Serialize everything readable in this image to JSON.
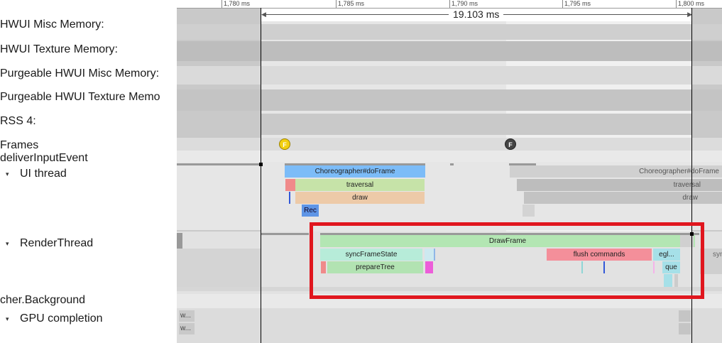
{
  "sidebar": {
    "tracks": [
      "HWUI Misc Memory:",
      "HWUI Texture Memory:",
      "Purgeable HWUI Misc Memory:",
      "Purgeable HWUI Texture Memo",
      "RSS 4:",
      "Frames",
      "deliverInputEvent",
      "UI thread",
      "RenderThread",
      "cher.Background",
      "GPU completion"
    ],
    "caret": "▾"
  },
  "ruler": {
    "ticks": [
      "1,780 ms",
      "1,785 ms",
      "1,790 ms",
      "1,795 ms",
      "1,800 ms"
    ],
    "selection_duration": "19.103 ms"
  },
  "frames": {
    "marker_label": "F",
    "colors": {
      "good": "#f2cf10",
      "janky": "#444444"
    }
  },
  "ui_thread": {
    "slices": [
      "Choreographer#doFrame",
      "traversal",
      "draw",
      "Rec"
    ],
    "faded_slices": [
      "Choreographer#doFrame",
      "traversal",
      "draw"
    ]
  },
  "render_thread": {
    "slices": [
      "DrawFrame",
      "syncFrameState",
      "prepareTree",
      "flush commands",
      "egl...",
      "que",
      "sync"
    ]
  },
  "gpu_completion": {
    "slices": [
      "w...",
      "w..."
    ]
  },
  "highlight": {
    "color": "#e0161e"
  }
}
